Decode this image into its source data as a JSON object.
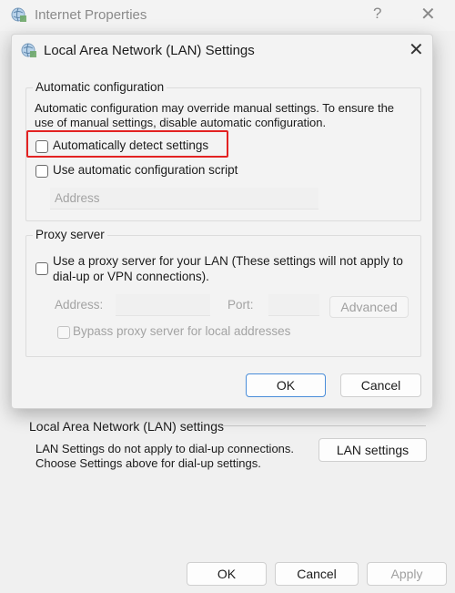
{
  "bg_window": {
    "title": "Internet Properties",
    "help_glyph": "?",
    "close_glyph": "✕",
    "lan_section": {
      "label": "Local Area Network (LAN) settings",
      "info_line1": "LAN Settings do not apply to dial-up connections.",
      "info_line2": "Choose Settings above for dial-up settings.",
      "button": "LAN settings"
    },
    "footer": {
      "ok": "OK",
      "cancel": "Cancel",
      "apply": "Apply"
    }
  },
  "dialog": {
    "title": "Local Area Network (LAN) Settings",
    "close_glyph": "✕",
    "auto_config": {
      "label": "Automatic configuration",
      "description_line1": "Automatic configuration may override manual settings.  To ensure the",
      "description_line2": "use of manual settings, disable automatic configuration.",
      "detect_label": "Automatically detect settings",
      "detect_checked": false,
      "script_label": "Use automatic configuration script",
      "script_checked": false,
      "address_placeholder": "Address"
    },
    "proxy": {
      "label": "Proxy server",
      "use_proxy_line1": "Use a proxy server for your LAN (These settings will not apply to",
      "use_proxy_line2": "dial-up or VPN connections).",
      "use_proxy_checked": false,
      "address_label": "Address:",
      "port_label": "Port:",
      "advanced_button": "Advanced",
      "bypass_label": "Bypass proxy server for local addresses",
      "bypass_checked": false
    },
    "ok_button": "OK",
    "cancel_button": "Cancel"
  },
  "colors": {
    "highlight": "#e32222",
    "accent": "#4a8dd9"
  }
}
